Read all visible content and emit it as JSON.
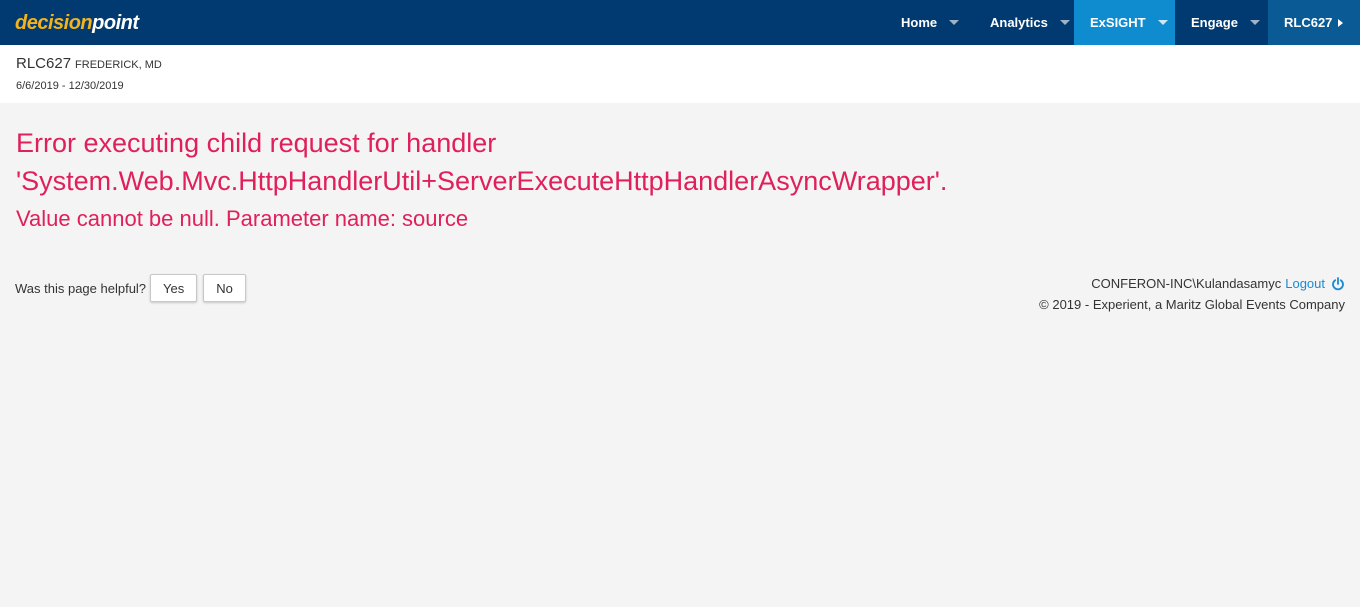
{
  "brand": {
    "part1": "decision",
    "part2": "point"
  },
  "nav": {
    "home": "Home",
    "analytics": "Analytics",
    "exsight": "ExSIGHT",
    "engage": "Engage",
    "account": "RLC627"
  },
  "property": {
    "code": "RLC627",
    "location": "FREDERICK, MD",
    "dates": "6/6/2019 - 12/30/2019"
  },
  "error": {
    "title": "Error executing child request for handler 'System.Web.Mvc.HttpHandlerUtil+ServerExecuteHttpHandlerAsyncWrapper'.",
    "detail": "Value cannot be null. Parameter name: source"
  },
  "feedback": {
    "question": "Was this page helpful?",
    "yes": "Yes",
    "no": "No"
  },
  "footer": {
    "user": "CONFERON-INC\\Kulandasamyc",
    "logout": "Logout",
    "copyright": "© 2019 - Experient, a Maritz Global Events Company"
  },
  "colors": {
    "navbar": "#003a70",
    "nav_active": "#0f8bd0",
    "nav_account": "#0a5a96",
    "error": "#e0205a",
    "link": "#1a8ad4",
    "logo_accent": "#f5b21a"
  }
}
